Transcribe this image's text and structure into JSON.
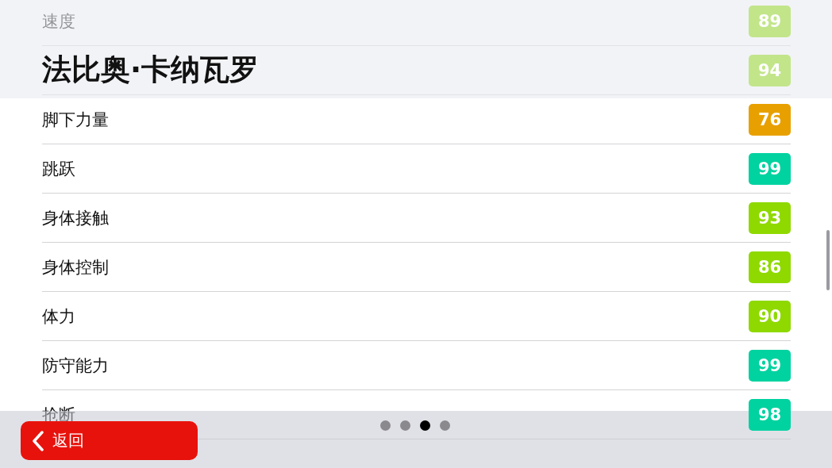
{
  "title": "法比奥·卡纳瓦罗",
  "stats": [
    {
      "label": "速度",
      "value": "89",
      "color": "#c2e58a"
    },
    {
      "value": "94",
      "color": "#c2e58a"
    },
    {
      "label": "脚下力量",
      "value": "76",
      "color": "#e8a000"
    },
    {
      "label": "跳跃",
      "value": "99",
      "color": "#00d2a0"
    },
    {
      "label": "身体接触",
      "value": "93",
      "color": "#8fd900"
    },
    {
      "label": "身体控制",
      "value": "86",
      "color": "#8fd900"
    },
    {
      "label": "体力",
      "value": "90",
      "color": "#8fd900"
    },
    {
      "label": "防守能力",
      "value": "99",
      "color": "#00d2a0"
    },
    {
      "label": "抢断",
      "value": "98",
      "color": "#00d2a0"
    }
  ],
  "pages": [
    {
      "selected": false
    },
    {
      "selected": false
    },
    {
      "selected": true
    },
    {
      "selected": false
    }
  ],
  "back_button": {
    "label": "返回"
  }
}
